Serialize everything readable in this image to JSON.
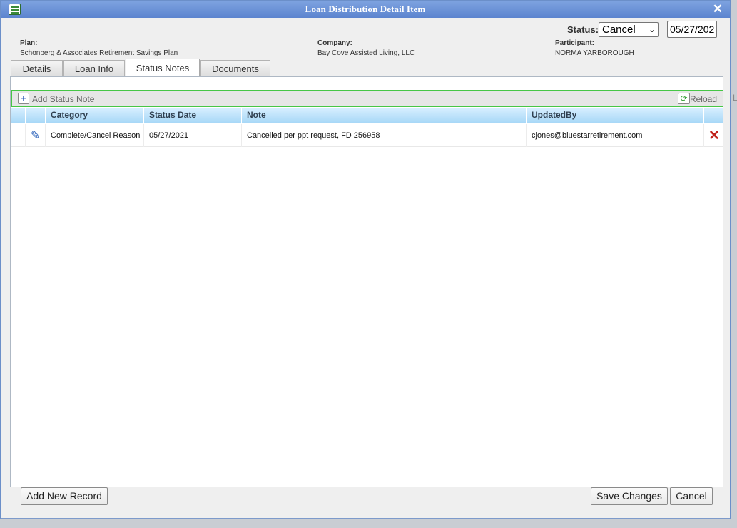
{
  "window": {
    "title": "Loan Distribution Detail Item",
    "close_icon": "close-icon"
  },
  "header": {
    "plan_label": "Plan:",
    "plan_value": "Schonberg & Associates Retirement Savings Plan",
    "company_label": "Company:",
    "company_value": "Bay Cove Assisted Living, LLC",
    "participant_label": "Participant:",
    "participant_value": "NORMA YARBOROUGH",
    "status_label": "Status:",
    "status_value": "Cancel",
    "date_value": "05/27/202"
  },
  "tabs": [
    {
      "label": "Details",
      "active": false
    },
    {
      "label": "Loan Info",
      "active": false
    },
    {
      "label": "Status Notes",
      "active": true
    },
    {
      "label": "Documents",
      "active": false
    }
  ],
  "toolbar": {
    "add_label": "Add Status Note",
    "reload_label": "Reload",
    "add_icon": "plus-icon",
    "reload_icon": "refresh-icon"
  },
  "grid": {
    "columns": [
      "Category",
      "Status Date",
      "Note",
      "UpdatedBy"
    ],
    "rows": [
      {
        "category": "Complete/Cancel Reason",
        "status_date": "05/27/2021",
        "note": "Cancelled per ppt request, FD 256958",
        "updated_by": "cjones@bluestarretirement.com"
      }
    ]
  },
  "footer": {
    "add_new_label": "Add New Record",
    "save_label": "Save Changes",
    "cancel_label": "Cancel"
  },
  "colors": {
    "titlebar": "#5c84cf",
    "toolbar_border": "#46c646",
    "grid_header": "#a8d8f7",
    "delete": "#c0221a",
    "edit": "#1c57b5"
  }
}
